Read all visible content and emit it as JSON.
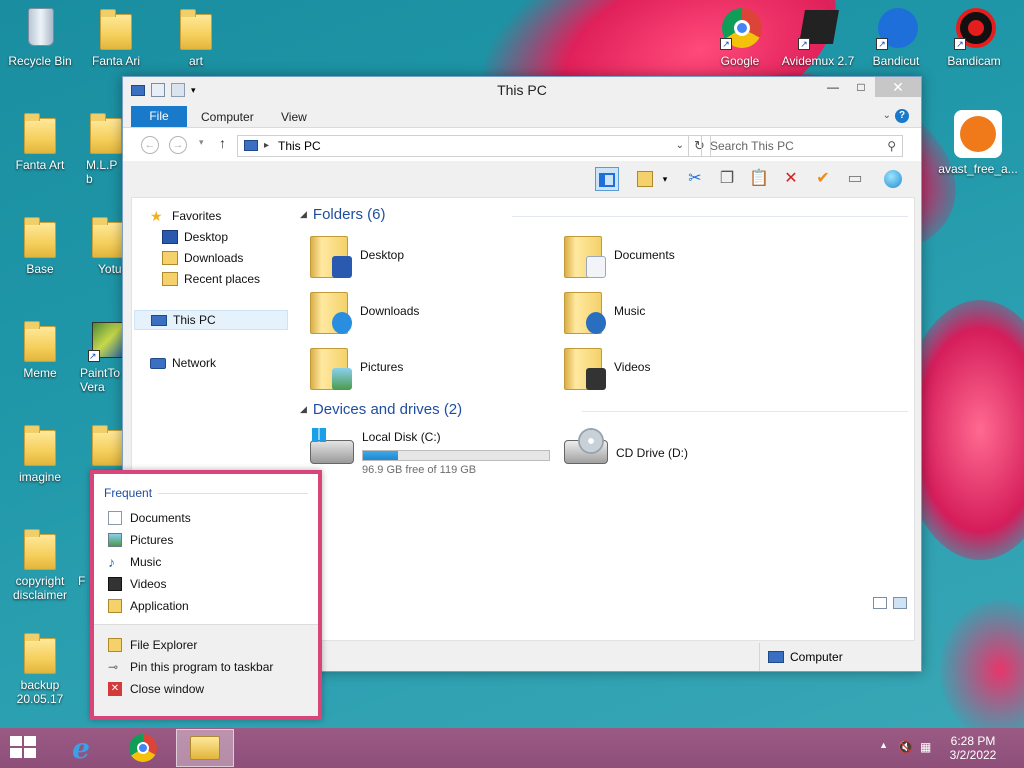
{
  "desktop": {
    "icons": [
      {
        "label": "Recycle Bin"
      },
      {
        "label": "Fanta Ari"
      },
      {
        "label": "art"
      },
      {
        "label": "Fanta Art"
      },
      {
        "label": "M.L.P b"
      },
      {
        "label": "Base"
      },
      {
        "label": "Yotu"
      },
      {
        "label": "Meme"
      },
      {
        "label": "PaintTo Vera"
      },
      {
        "label": "imagine"
      },
      {
        "label": "copyright disclaimer"
      },
      {
        "label": "F"
      },
      {
        "label": "backup 20.05.17"
      },
      {
        "label": "Google"
      },
      {
        "label": "Avidemux 2.7"
      },
      {
        "label": "Bandicut"
      },
      {
        "label": "Bandicam"
      },
      {
        "label": "avast_free_a..."
      }
    ]
  },
  "window": {
    "title": "This PC",
    "controls": {
      "minimize": "—",
      "maximize": "□",
      "close": "✕"
    },
    "tabs": [
      "File",
      "Computer",
      "View"
    ],
    "address": {
      "crumb": "This PC"
    },
    "search": {
      "placeholder": "Search This PC"
    },
    "nav": {
      "favorites": "Favorites",
      "desktop": "Desktop",
      "downloads": "Downloads",
      "recent": "Recent places",
      "thispc": "This PC",
      "network": "Network"
    },
    "folders_header": "Folders (6)",
    "folders": [
      "Desktop",
      "Documents",
      "Downloads",
      "Music",
      "Pictures",
      "Videos"
    ],
    "drives_header": "Devices and drives (2)",
    "drives": [
      {
        "name": "Local Disk (C:)",
        "free": "96.9 GB free of 119 GB",
        "used_fraction": 0.19
      },
      {
        "name": "CD Drive (D:)"
      }
    ],
    "status": {
      "computer": "Computer"
    }
  },
  "jumplist": {
    "header": "Frequent",
    "frequent": [
      "Documents",
      "Pictures",
      "Music",
      "Videos",
      "Application"
    ],
    "tasks": [
      "File Explorer",
      "Pin this program to taskbar",
      "Close window"
    ]
  },
  "taskbar": {
    "time": "6:28 PM",
    "date": "3/2/2022"
  },
  "colors": {
    "accent": "#1979ca",
    "jump_border": "#d7457a",
    "taskbar": "#8d4f7a"
  }
}
